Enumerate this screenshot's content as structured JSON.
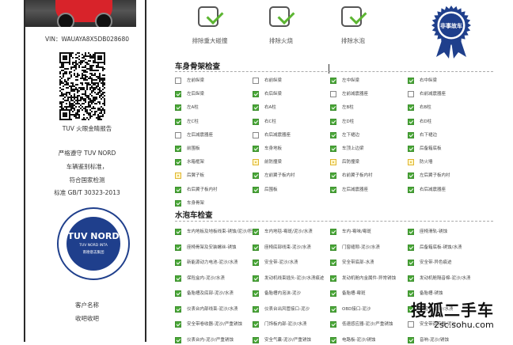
{
  "left_panel": {
    "vin": "VIN：WAUAYA8X5DB028680",
    "qr_caption": "TUV 火眼金睛报告",
    "statement": [
      "严格遵守 TUV NORD",
      "车辆鉴别标准，",
      "符合国家检测",
      "标准 GB/T 30323-2013"
    ],
    "stamp": {
      "title": "TUV NORD",
      "line1": "TUV NORD INTA",
      "line2": "南德意志集团"
    },
    "customer_name_label": "客户名称",
    "customer_name_value": "收吧收吧"
  },
  "top_checks": [
    {
      "label": "排除重大碰撞"
    },
    {
      "label": "排除火烧"
    },
    {
      "label": "排除水泡"
    }
  ],
  "badge": {
    "text": "非事故车"
  },
  "sections": [
    {
      "title": "车身骨架检查",
      "rows": [
        [
          {
            "s": "n",
            "t": "左前纵梁"
          },
          {
            "s": "n",
            "t": "右前纵梁"
          },
          {
            "s": "g",
            "t": "左中纵梁"
          },
          {
            "s": "g",
            "t": "右中纵梁"
          }
        ],
        [
          {
            "s": "g",
            "t": "左后纵梁"
          },
          {
            "s": "g",
            "t": "右后纵梁"
          },
          {
            "s": "n",
            "t": "左前减震器座"
          },
          {
            "s": "n",
            "t": "右前减震器座"
          }
        ],
        [
          {
            "s": "g",
            "t": "左A柱"
          },
          {
            "s": "g",
            "t": "右A柱"
          },
          {
            "s": "g",
            "t": "左B柱"
          },
          {
            "s": "g",
            "t": "右B柱"
          }
        ],
        [
          {
            "s": "g",
            "t": "左C柱"
          },
          {
            "s": "g",
            "t": "右C柱"
          },
          {
            "s": "g",
            "t": "左D柱"
          },
          {
            "s": "g",
            "t": "右D柱"
          }
        ],
        [
          {
            "s": "n",
            "t": "左后减震器座"
          },
          {
            "s": "n",
            "t": "右后减震器座"
          },
          {
            "s": "g",
            "t": "左下裙边"
          },
          {
            "s": "g",
            "t": "右下裙边"
          }
        ],
        [
          {
            "s": "g",
            "t": "前围板"
          },
          {
            "s": "g",
            "t": "车身地板"
          },
          {
            "s": "g",
            "t": "车顶上边梁"
          },
          {
            "s": "g",
            "t": "后备箱底板"
          }
        ],
        [
          {
            "s": "g",
            "t": "水箱框架"
          },
          {
            "s": "y",
            "t": "前防撞梁"
          },
          {
            "s": "y",
            "t": "后防撞梁"
          },
          {
            "s": "y",
            "t": "防火墙"
          }
        ],
        [
          {
            "s": "y",
            "t": "后翼子板"
          },
          {
            "s": "g",
            "t": "左前翼子板内衬"
          },
          {
            "s": "g",
            "t": "右前翼子板内衬"
          },
          {
            "s": "g",
            "t": "左后翼子板内衬"
          }
        ],
        [
          {
            "s": "g",
            "t": "右后翼子板内衬"
          },
          {
            "s": "g",
            "t": "后围板"
          },
          {
            "s": "g",
            "t": "左后减震器座"
          },
          {
            "s": "g",
            "t": "右后减震器座"
          }
        ],
        [
          {
            "s": "g",
            "t": "车身骨架"
          }
        ]
      ]
    },
    {
      "title": "水泡车检查",
      "rows": [
        [
          {
            "s": "g",
            "t": "车内地板及地板线束-锈蚀/泥沙/积水"
          },
          {
            "s": "g",
            "t": "车内地毯-霉斑/泥沙/水渍"
          },
          {
            "s": "g",
            "t": "车内-霉味/霉斑"
          },
          {
            "s": "g",
            "t": "座椅滑轨-锈蚀"
          }
        ],
        [
          {
            "s": "g",
            "t": "座椅骨架及安装螺丝-锈蚀"
          },
          {
            "s": "g",
            "t": "座椅底部线束-泥沙/水渍"
          },
          {
            "s": "g",
            "t": "门窗缝隙-泥沙/水渍"
          },
          {
            "s": "g",
            "t": "后备箱底板-锈蚀/水渍"
          }
        ],
        [
          {
            "s": "g",
            "t": "新能源动力电池-泥沙/水渍"
          },
          {
            "s": "g",
            "t": "安全带-泥沙/水渍"
          },
          {
            "s": "g",
            "t": "安全带底部-水渍"
          },
          {
            "s": "g",
            "t": "安全带-异色痕迹"
          }
        ],
        [
          {
            "s": "g",
            "t": "保险盒内-泥沙/水渍"
          },
          {
            "s": "g",
            "t": "发动机线束插头-泥沙/水渍痕迹"
          },
          {
            "s": "g",
            "t": "发动机舱内金属件-异常锈蚀"
          },
          {
            "s": "g",
            "t": "发动机舱隔音棉-泥沙/水渍"
          }
        ],
        [
          {
            "s": "g",
            "t": "备胎槽及底部-泥沙/水渍"
          },
          {
            "s": "g",
            "t": "备胎槽内泡沫-泥沙"
          },
          {
            "s": "g",
            "t": "备胎槽-霉斑"
          },
          {
            "s": "g",
            "t": "备胎槽-锈蚀"
          }
        ],
        [
          {
            "s": "g",
            "t": "仪表台内部线束-泥沙/水渍"
          },
          {
            "s": "g",
            "t": "仪表台出风管接口-泥沙"
          },
          {
            "s": "g",
            "t": "OBD接口-泥沙"
          },
          {
            "s": "g",
            "t": "中控台-泥沙/水渍"
          }
        ],
        [
          {
            "s": "g",
            "t": "安全带卷收器-泥沙/严重锈蚀"
          },
          {
            "s": "g",
            "t": "门饰板内部-泥沙/水渍"
          },
          {
            "s": "g",
            "t": "低速感应器-泥沙/严重锈蚀"
          },
          {
            "s": "n",
            "t": "安全带调节器-泥沙"
          }
        ],
        [
          {
            "s": "g",
            "t": "仪表台内-泥沙/严重锈蚀"
          },
          {
            "s": "g",
            "t": "安全气囊-泥沙/严重锈蚀"
          },
          {
            "s": "g",
            "t": "电路板-泥沙/锈蚀"
          },
          {
            "s": "g",
            "t": "音响-泥沙/锈蚀"
          }
        ]
      ]
    }
  ],
  "watermark": {
    "brand": "搜狐二手车",
    "url": "2sc.sohu.com"
  },
  "colors": {
    "check_green": "#4aa838",
    "warn_yellow": "#e0b630",
    "stamp_blue": "#1f3f8c",
    "badge_blue": "#1f3f8c"
  }
}
